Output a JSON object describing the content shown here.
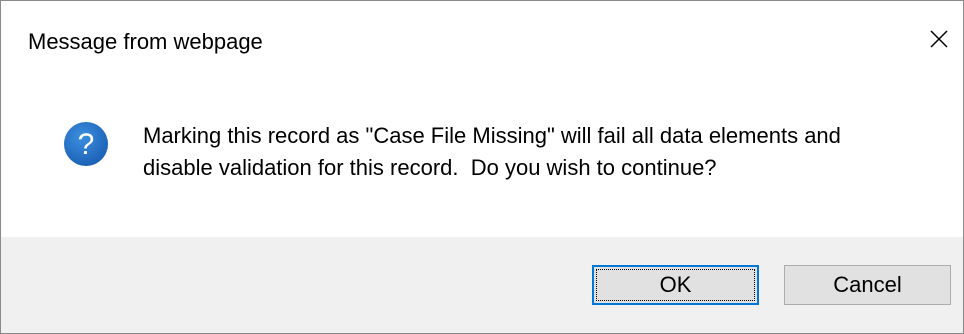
{
  "dialog": {
    "title": "Message from webpage",
    "close_icon": "close-icon",
    "icon": "question-icon",
    "icon_glyph": "?",
    "message_lines": [
      "Marking this record as \"Case File Missing\" will fail all data elements and",
      "disable validation for this record.  Do you wish to continue?"
    ],
    "buttons": {
      "ok_label": "OK",
      "cancel_label": "Cancel"
    }
  },
  "colors": {
    "icon_blue": "#1a6fc9",
    "focus_border": "#0078d7",
    "footer_bg": "#f0f0f0",
    "button_bg": "#e1e1e1"
  }
}
